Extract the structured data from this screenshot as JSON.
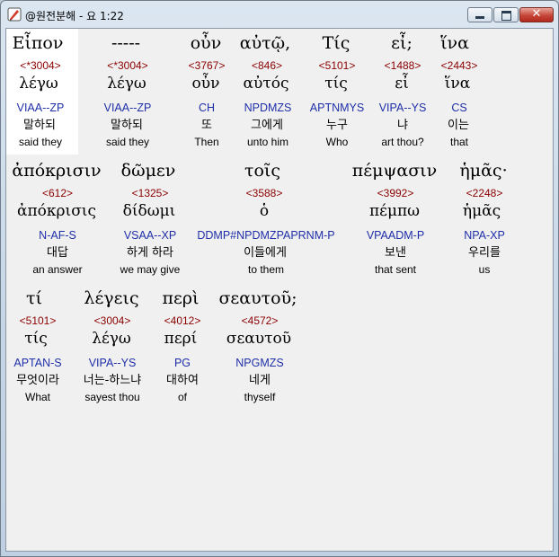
{
  "window": {
    "title": "@원전분해 - 요 1:22",
    "close_glyph": "✕"
  },
  "words": [
    {
      "greek": "Εἶπον",
      "strongs": "<*3004>",
      "lemma": "λέγω",
      "morph": "VIAA--ZP",
      "korean": "말하되",
      "english": "said they"
    },
    {
      "greek": "-----",
      "strongs": "<*3004>",
      "lemma": "λέγω",
      "morph": "VIAA--ZP",
      "korean": "말하되",
      "english": "said they"
    },
    {
      "greek": "οὖν",
      "strongs": "<3767>",
      "lemma": "οὖν",
      "morph": "CH",
      "korean": "또",
      "english": "Then"
    },
    {
      "greek": "αὐτῷ,",
      "strongs": "<846>",
      "lemma": "αὐτός",
      "morph": "NPDMZS",
      "korean": "그에게",
      "english": "unto him"
    },
    {
      "greek": "Τίς",
      "strongs": "<5101>",
      "lemma": "τίς",
      "morph": "APTNMYS",
      "korean": "누구",
      "english": "Who"
    },
    {
      "greek": "εἶ;",
      "strongs": "<1488>",
      "lemma": "εἶ",
      "morph": "VIPA--YS",
      "korean": "냐",
      "english": "art thou?"
    },
    {
      "greek": "ἵνα",
      "strongs": "<2443>",
      "lemma": "ἵνα",
      "morph": "CS",
      "korean": "이는",
      "english": "that"
    },
    {
      "greek": "ἀπόκρισιν",
      "strongs": "<612>",
      "lemma": "ἀπόκρισις",
      "morph": "N-AF-S",
      "korean": "대답",
      "english": "an answer"
    },
    {
      "greek": "δῶμεν",
      "strongs": "<1325>",
      "lemma": "δίδωμι",
      "morph": "VSAA--XP",
      "korean": "하게 하라",
      "english": "we may give"
    },
    {
      "greek": "τοῖς",
      "strongs": "<3588>",
      "lemma": "ὁ",
      "morph": "DDMP#NPDMZPAPRNM-P",
      "korean": "이들에게",
      "english": "to them"
    },
    {
      "greek": "πέμψασιν",
      "strongs": "<3992>",
      "lemma": "πέμπω",
      "morph": "VPAADM-P",
      "korean": "보낸",
      "english": "that sent"
    },
    {
      "greek": "ἡμᾶς·",
      "strongs": "<2248>",
      "lemma": "ἡμᾶς",
      "morph": "NPA-XP",
      "korean": "우리를",
      "english": "us"
    },
    {
      "greek": "τί",
      "strongs": "<5101>",
      "lemma": "τίς",
      "morph": "APTAN-S",
      "korean": "무엇이라",
      "english": "What"
    },
    {
      "greek": "λέγεις",
      "strongs": "<3004>",
      "lemma": "λέγω",
      "morph": "VIPA--YS",
      "korean": "너는-하느냐",
      "english": "sayest thou"
    },
    {
      "greek": "περὶ",
      "strongs": "<4012>",
      "lemma": "περί",
      "morph": "PG",
      "korean": "대하여",
      "english": "of"
    },
    {
      "greek": "σεαυτοῦ;",
      "strongs": "<4572>",
      "lemma": "σεαυτοῦ",
      "morph": "NPGMZS",
      "korean": "네게",
      "english": "thyself"
    }
  ]
}
